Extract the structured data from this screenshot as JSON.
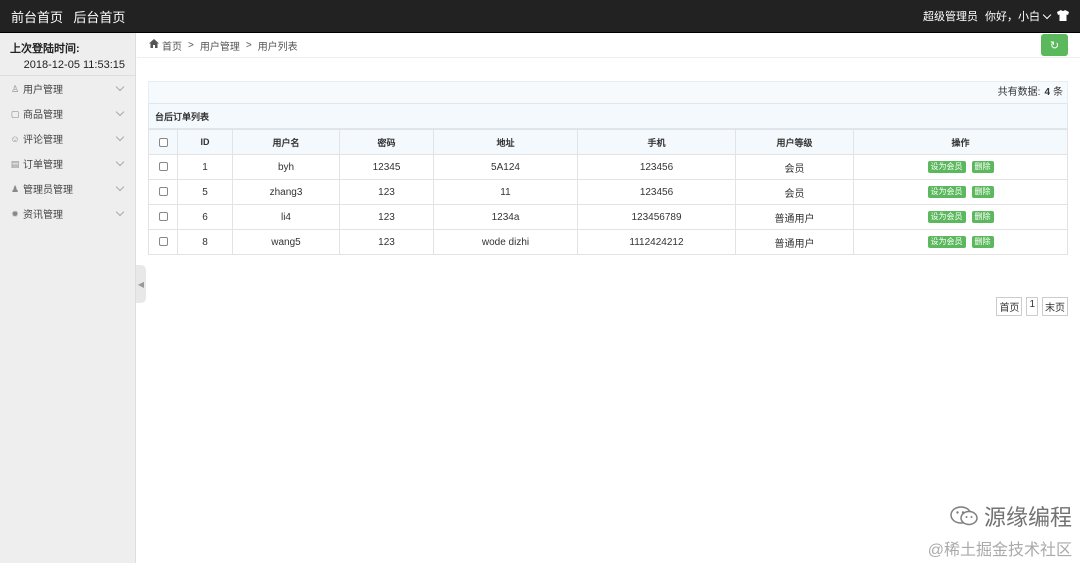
{
  "topbar": {
    "nav": [
      "前台首页",
      "后台首页"
    ],
    "role": "超级管理员",
    "greeting": "你好，小白"
  },
  "sidebar": {
    "login_label": "上次登陆时间:",
    "login_time": "2018-12-05 11:53:15",
    "items": [
      {
        "label": "用户管理",
        "icon": "user-icon"
      },
      {
        "label": "商品管理",
        "icon": "bag-icon"
      },
      {
        "label": "评论管理",
        "icon": "comment-icon"
      },
      {
        "label": "订单管理",
        "icon": "order-icon"
      },
      {
        "label": "管理员管理",
        "icon": "admin-icon"
      },
      {
        "label": "资讯管理",
        "icon": "gear-icon"
      }
    ]
  },
  "breadcrumb": [
    "首页",
    "用户管理",
    "用户列表"
  ],
  "total": {
    "label": "共有数据:",
    "count": "4",
    "unit": "条"
  },
  "table": {
    "caption": "台后订单列表",
    "headers": [
      "ID",
      "用户名",
      "密码",
      "地址",
      "手机",
      "用户等级",
      "操作"
    ],
    "rows": [
      {
        "id": "1",
        "username": "byh",
        "password": "12345",
        "address": "5A124",
        "phone": "123456",
        "level": "会员"
      },
      {
        "id": "5",
        "username": "zhang3",
        "password": "123",
        "address": "11",
        "phone": "123456",
        "level": "会员"
      },
      {
        "id": "6",
        "username": "li4",
        "password": "123",
        "address": "1234a",
        "phone": "123456789",
        "level": "普通用户"
      },
      {
        "id": "8",
        "username": "wang5",
        "password": "123",
        "address": "wode dizhi",
        "phone": "1112424212",
        "level": "普通用户"
      }
    ],
    "actions": [
      "设为会员",
      "删除"
    ]
  },
  "pager": [
    "首页",
    "1",
    "末页"
  ],
  "watermark": {
    "line1": "源缘编程",
    "line2": "@稀土掘金技术社区"
  },
  "colors": {
    "accent": "#5cb85c",
    "topbar": "#222222"
  }
}
